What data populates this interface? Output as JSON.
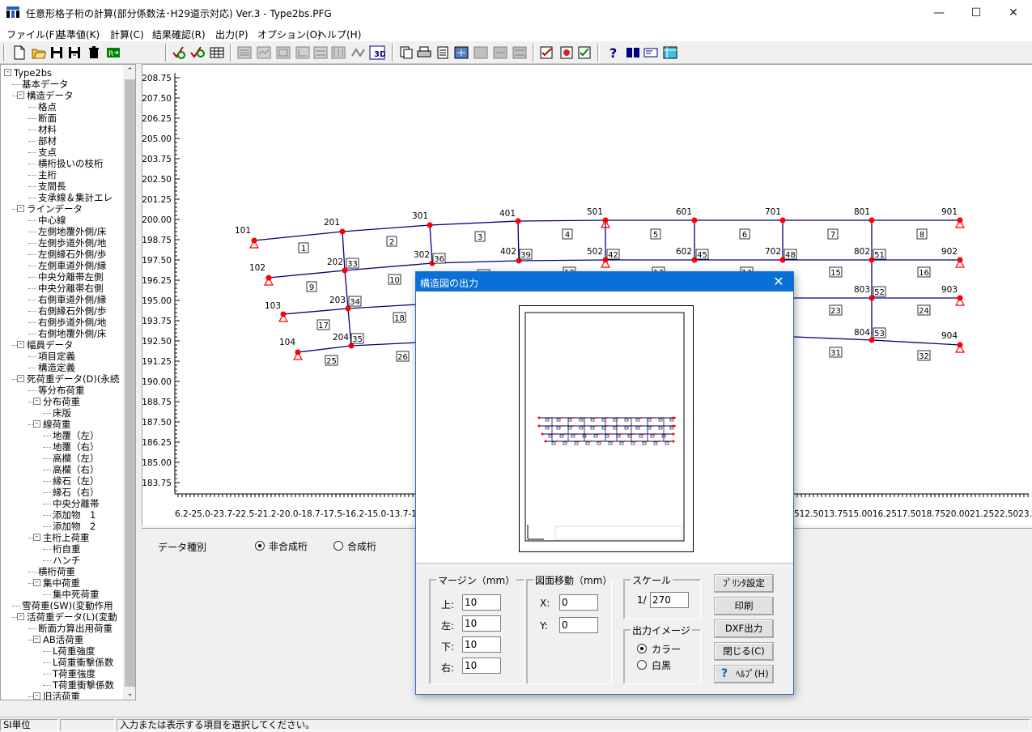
{
  "window": {
    "title": "任意形格子桁の計算(部分係数法･H29道示対応) Ver.3 - Type2bs.PFG",
    "minimize": "—",
    "maximize": "☐",
    "close": "✕"
  },
  "menu": [
    "ファイル(F)",
    "基準値(K)",
    "計算(C)",
    "結果確認(R)",
    "出力(P)",
    "オプション(O)",
    "ヘルプ(H)"
  ],
  "tree": [
    {
      "label": "Type2bs",
      "level": 0,
      "expander": "-"
    },
    {
      "label": "基本データ",
      "level": 1
    },
    {
      "label": "構造データ",
      "level": 1,
      "expander": "-"
    },
    {
      "label": "格点",
      "level": 2
    },
    {
      "label": "断面",
      "level": 2
    },
    {
      "label": "材料",
      "level": 2
    },
    {
      "label": "部材",
      "level": 2
    },
    {
      "label": "支点",
      "level": 2
    },
    {
      "label": "横桁扱いの枝桁",
      "level": 2
    },
    {
      "label": "主桁",
      "level": 2
    },
    {
      "label": "支間長",
      "level": 2
    },
    {
      "label": "支承線＆集計エレ",
      "level": 2
    },
    {
      "label": "ラインデータ",
      "level": 1,
      "expander": "-"
    },
    {
      "label": "中心線",
      "level": 2
    },
    {
      "label": "左側地覆外側/床",
      "level": 2
    },
    {
      "label": "左側歩道外側/地",
      "level": 2
    },
    {
      "label": "左側縁石外側/歩",
      "level": 2
    },
    {
      "label": "左側車道外側/縁",
      "level": 2
    },
    {
      "label": "中央分離帯左側",
      "level": 2
    },
    {
      "label": "中央分離帯右側",
      "level": 2
    },
    {
      "label": "右側車道外側/縁",
      "level": 2
    },
    {
      "label": "右側縁石外側/歩",
      "level": 2
    },
    {
      "label": "右側歩道外側/地",
      "level": 2
    },
    {
      "label": "右側地覆外側/床",
      "level": 2
    },
    {
      "label": "幅員データ",
      "level": 1,
      "expander": "-"
    },
    {
      "label": "項目定義",
      "level": 2
    },
    {
      "label": "構造定義",
      "level": 2
    },
    {
      "label": "死荷重データ(D)(永続",
      "level": 1,
      "expander": "-"
    },
    {
      "label": "等分布荷重",
      "level": 2
    },
    {
      "label": "分布荷重",
      "level": 2,
      "expander": "-"
    },
    {
      "label": "床版",
      "level": 3
    },
    {
      "label": "線荷重",
      "level": 2,
      "expander": "-"
    },
    {
      "label": "地覆（左）",
      "level": 3
    },
    {
      "label": "地覆（右）",
      "level": 3
    },
    {
      "label": "高欄（左）",
      "level": 3
    },
    {
      "label": "高欄（右）",
      "level": 3
    },
    {
      "label": "縁石（左）",
      "level": 3
    },
    {
      "label": "縁石（右）",
      "level": 3
    },
    {
      "label": "中央分離帯",
      "level": 3
    },
    {
      "label": "添加物　1",
      "level": 3
    },
    {
      "label": "添加物　2",
      "level": 3
    },
    {
      "label": "主桁上荷重",
      "level": 2,
      "expander": "-"
    },
    {
      "label": "桁自重",
      "level": 3
    },
    {
      "label": "ハンチ",
      "level": 3
    },
    {
      "label": "横桁荷重",
      "level": 2
    },
    {
      "label": "集中荷重",
      "level": 2,
      "expander": "-"
    },
    {
      "label": "集中死荷重",
      "level": 3
    },
    {
      "label": "雪荷重(SW)(変動作用",
      "level": 1
    },
    {
      "label": "活荷重データ(L)(変動",
      "level": 1,
      "expander": "-"
    },
    {
      "label": "断面力算出用荷重",
      "level": 2
    },
    {
      "label": "AB活荷重",
      "level": 2,
      "expander": "-"
    },
    {
      "label": "L荷重強度",
      "level": 3
    },
    {
      "label": "L荷重衝撃係数",
      "level": 3
    },
    {
      "label": "T荷重強度",
      "level": 3
    },
    {
      "label": "T荷重衝撃係数",
      "level": 3
    },
    {
      "label": "旧活荷重",
      "level": 2,
      "expander": "-"
    }
  ],
  "graph": {
    "y_ticks": [
      "208.75",
      "207.50",
      "206.25",
      "205.00",
      "203.75",
      "202.50",
      "201.25",
      "200.00",
      "198.75",
      "197.50",
      "196.25",
      "195.00",
      "193.75",
      "192.50",
      "191.25",
      "190.00",
      "188.75",
      "187.50",
      "186.25",
      "185.00",
      "183.75"
    ],
    "x_axis_left": "6.2-25.0-23.7-22.5-21.2-20.0-18.7-17.5-16.2-15.0-13.7-12.5-",
    "x_axis_right": "512.5013.7515.0016.2517.5018.7520.0021.2522.5023.7525.00",
    "node_labels": [
      "101",
      "201",
      "301",
      "401",
      "501",
      "601",
      "701",
      "801",
      "901",
      "102",
      "202",
      "302",
      "402",
      "502",
      "602",
      "702",
      "802",
      "902",
      "103",
      "203",
      "803",
      "903",
      "104",
      "204",
      "804",
      "904"
    ],
    "member_labels": [
      "1",
      "2",
      "3",
      "4",
      "5",
      "6",
      "7",
      "8",
      "9",
      "10",
      "11",
      "12",
      "13",
      "14",
      "15",
      "16",
      "17",
      "18",
      "23",
      "24",
      "25",
      "26",
      "31",
      "32",
      "33",
      "34",
      "35",
      "36",
      "39",
      "42",
      "45",
      "48",
      "51",
      "52",
      "53"
    ]
  },
  "bottom_panel": {
    "data_type_label": "データ種別",
    "option_noncomposite": "非合成桁",
    "option_composite": "合成桁"
  },
  "status": {
    "units": "SI単位",
    "middle": "",
    "message": "入力または表示する項目を選択してください。"
  },
  "dialog": {
    "title": "構造図の出力",
    "margin_group": "マージン（mm）",
    "margin_top_label": "上:",
    "margin_top": "10",
    "margin_left_label": "左:",
    "margin_left": "10",
    "margin_bottom_label": "下:",
    "margin_bottom": "10",
    "margin_right_label": "右:",
    "margin_right": "10",
    "move_group": "図面移動（mm）",
    "move_x_label": "X:",
    "move_x": "0",
    "move_y_label": "Y:",
    "move_y": "0",
    "scale_group": "スケール",
    "scale_prefix": "1/",
    "scale_value": "270",
    "image_group": "出力イメージ",
    "image_color": "カラー",
    "image_bw": "白黒",
    "btn_printer": "ﾌﾟﾘﾝﾀ設定",
    "btn_print": "印刷",
    "btn_dxf": "DXF出力",
    "btn_close": "閉じる(C)",
    "btn_help": "ﾍﾙﾌﾟ(H)"
  },
  "colors": {
    "line": "#000080",
    "node": "#ff0000",
    "titlebar": "#0a6fd6"
  }
}
